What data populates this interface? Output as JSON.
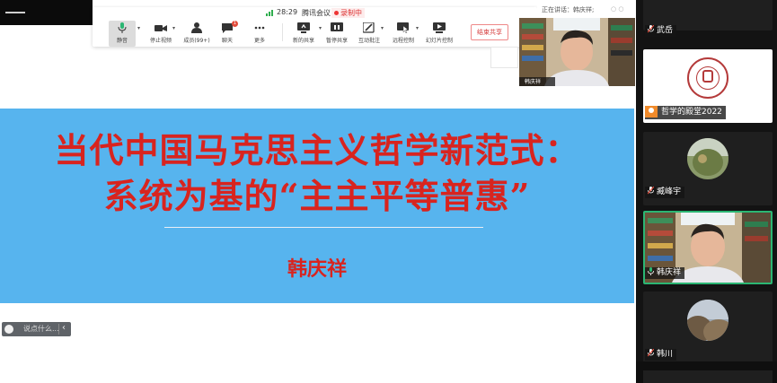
{
  "toolbar": {
    "time": "28:29",
    "app_name": "腾讯会议",
    "recording_label": "录制中",
    "mute_label": "静音",
    "video_label": "停止视频",
    "members_label": "成员(99+)",
    "chat_label": "聊天",
    "chat_badge": "1",
    "more_label": "更多",
    "new_share_label": "新的共享",
    "pause_share_label": "暂停共享",
    "annotate_label": "互动批注",
    "remote_label": "远程控制",
    "slideshow_label": "幻灯片控制",
    "end_share_label": "结束共享"
  },
  "speaker": {
    "speaking_text": "正在讲话：韩庆祥;",
    "thumb_name": "韩庆祥"
  },
  "slide": {
    "title_line1": "当代中国马克思主义哲学新范式：",
    "title_line2": "系统为基的“主主平等普惠”",
    "author": "韩庆祥",
    "colors": {
      "band": "#57b4ee",
      "text": "#d8241f"
    }
  },
  "chat_input": {
    "placeholder": "说点什么..."
  },
  "participants": [
    {
      "name": "武岳",
      "muted": true
    },
    {
      "name": "哲学的殿堂2022",
      "muted": true
    },
    {
      "name": "臧峰宇",
      "muted": true
    },
    {
      "name": "韩庆祥",
      "muted": false,
      "active": true
    },
    {
      "name": "韩川",
      "muted": true
    }
  ],
  "colors": {
    "accent_green": "#2bb673",
    "mute_red": "#e24b3b",
    "sidebar_bg": "#131313"
  },
  "icons": [
    "mic-icon",
    "video-icon",
    "members-icon",
    "chat-icon",
    "more-icon",
    "new-share-icon",
    "pause-share-icon",
    "annotate-icon",
    "remote-control-icon",
    "slideshow-icon",
    "signal-icon",
    "recording-dot-icon"
  ]
}
